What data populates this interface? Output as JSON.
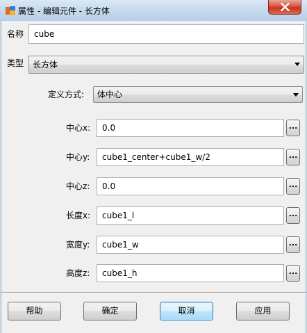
{
  "window": {
    "title": "属性 - 编辑元件 - 长方体",
    "icon": "app-icon",
    "close_icon": "close-icon"
  },
  "form": {
    "name_label": "名称",
    "name_value": "cube",
    "type_label": "类型",
    "type_value": "长方体",
    "definition_label": "定义方式:",
    "definition_value": "体中心",
    "fields": [
      {
        "label": "中心x:",
        "value": "0.0"
      },
      {
        "label": "中心y:",
        "value": "cube1_center+cube1_w/2"
      },
      {
        "label": "中心z:",
        "value": "0.0"
      },
      {
        "label": "长度x:",
        "value": "cube1_l"
      },
      {
        "label": "宽度y:",
        "value": "cube1_w"
      },
      {
        "label": "高度z:",
        "value": "cube1_h"
      }
    ],
    "browse_label": "..."
  },
  "buttons": {
    "help": "帮助",
    "ok": "确定",
    "cancel": "取消",
    "apply": "应用"
  }
}
